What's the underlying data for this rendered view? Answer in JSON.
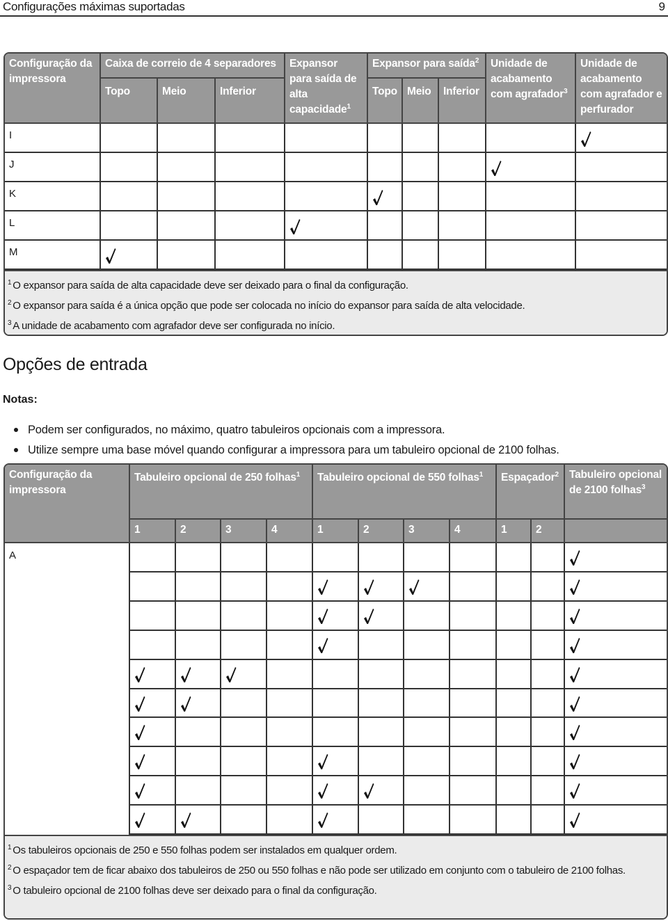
{
  "page": {
    "header_title": "Configurações máximas suportadas",
    "page_number": "9"
  },
  "output_table": {
    "headers": {
      "config": "Configuração da impressora",
      "mailbox_group": "Caixa de correio de 4 separadores",
      "mailbox_sub": [
        "Topo",
        "Meio",
        "Inferior"
      ],
      "hc_expander": "Expansor para saída de alta capacidade",
      "hc_expander_sup": "1",
      "expander_group": "Expansor para saída",
      "expander_group_sup": "2",
      "expander_sub": [
        "Topo",
        "Meio",
        "Inferior"
      ],
      "stapler": "Unidade de acabamento com agrafador",
      "stapler_sup": "3",
      "stapler_punch": "Unidade de acabamento com agrafador e perfurador"
    },
    "columns": [
      "mailbox_top",
      "mailbox_middle",
      "mailbox_bottom",
      "hc_expander",
      "expander_top",
      "expander_middle",
      "expander_bottom",
      "stapler",
      "stapler_punch"
    ],
    "rows": [
      {
        "label": "I",
        "checks": [
          false,
          false,
          false,
          false,
          false,
          false,
          false,
          false,
          true
        ]
      },
      {
        "label": "J",
        "checks": [
          false,
          false,
          false,
          false,
          false,
          false,
          false,
          true,
          false
        ]
      },
      {
        "label": "K",
        "checks": [
          false,
          false,
          false,
          false,
          true,
          false,
          false,
          false,
          false
        ]
      },
      {
        "label": "L",
        "checks": [
          false,
          false,
          false,
          true,
          false,
          false,
          false,
          false,
          false
        ]
      },
      {
        "label": "M",
        "checks": [
          true,
          false,
          false,
          false,
          false,
          false,
          false,
          false,
          false
        ]
      }
    ],
    "footnotes": [
      {
        "num": "1",
        "text": "O expansor para saída de alta capacidade deve ser deixado para o final da configuração."
      },
      {
        "num": "2",
        "text": "O expansor para saída é a única opção que pode ser colocada no início do expansor para saída de alta velocidade."
      },
      {
        "num": "3",
        "text": "A unidade de acabamento com agrafador deve ser configurada no início."
      }
    ]
  },
  "input_section": {
    "title": "Opções de entrada",
    "notes_label": "Notas:",
    "bullets": [
      "Podem ser configurados, no máximo, quatro tabuleiros opcionais com a impressora.",
      "Utilize sempre uma base móvel quando configurar a impressora para um tabuleiro opcional de 2100 folhas."
    ]
  },
  "input_table": {
    "headers": {
      "config": "Configuração da impressora",
      "tray250": "Tabuleiro opcional de 250 folhas",
      "tray250_sup": "1",
      "tray550": "Tabuleiro opcional de 550 folhas",
      "tray550_sup": "1",
      "spacer": "Espaçador",
      "spacer_sup": "2",
      "tray2100": "Tabuleiro opcional de 2100 folhas",
      "tray2100_sup": "3",
      "sub": [
        "1",
        "2",
        "3",
        "4",
        "1",
        "2",
        "3",
        "4",
        "1",
        "2"
      ]
    },
    "config_label": "A",
    "rows": [
      [
        false,
        false,
        false,
        false,
        false,
        false,
        false,
        false,
        false,
        false,
        true
      ],
      [
        false,
        false,
        false,
        false,
        true,
        true,
        true,
        false,
        false,
        false,
        true
      ],
      [
        false,
        false,
        false,
        false,
        true,
        true,
        false,
        false,
        false,
        false,
        true
      ],
      [
        false,
        false,
        false,
        false,
        true,
        false,
        false,
        false,
        false,
        false,
        true
      ],
      [
        true,
        true,
        true,
        false,
        false,
        false,
        false,
        false,
        false,
        false,
        true
      ],
      [
        true,
        true,
        false,
        false,
        false,
        false,
        false,
        false,
        false,
        false,
        true
      ],
      [
        true,
        false,
        false,
        false,
        false,
        false,
        false,
        false,
        false,
        false,
        true
      ],
      [
        true,
        false,
        false,
        false,
        true,
        false,
        false,
        false,
        false,
        false,
        true
      ],
      [
        true,
        false,
        false,
        false,
        true,
        true,
        false,
        false,
        false,
        false,
        true
      ],
      [
        true,
        true,
        false,
        false,
        true,
        false,
        false,
        false,
        false,
        false,
        true
      ]
    ],
    "footnotes": [
      {
        "num": "1",
        "text": "Os tabuleiros opcionais de 250 e 550 folhas podem ser instalados em qualquer ordem."
      },
      {
        "num": "2",
        "text": "O espaçador tem de ficar abaixo dos tabuleiros de 250 ou 550 folhas e não pode ser utilizado em conjunto com o tabuleiro de 2100 folhas."
      },
      {
        "num": "3",
        "text": "O tabuleiro opcional de 2100 folhas deve ser deixado para o final da configuração."
      }
    ]
  }
}
